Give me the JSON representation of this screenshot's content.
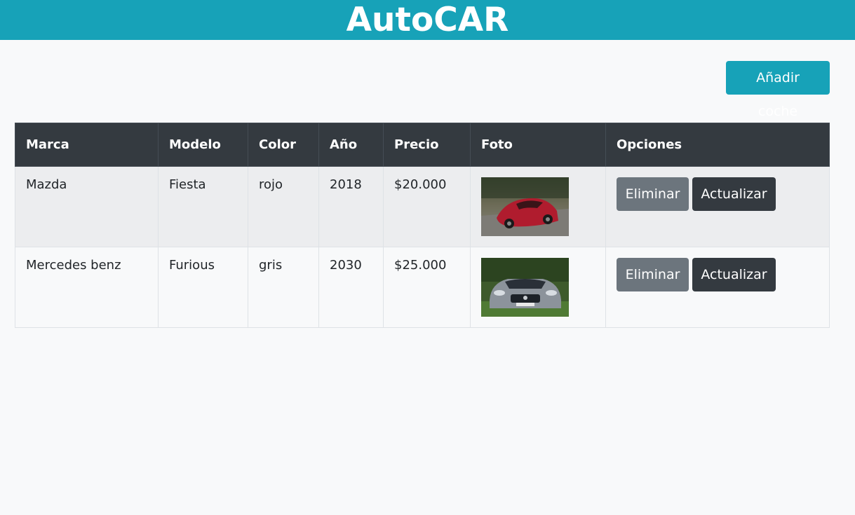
{
  "header": {
    "title": "AutoCAR"
  },
  "toolbar": {
    "add_label": "Añadir coche"
  },
  "table": {
    "columns": [
      "Marca",
      "Modelo",
      "Color",
      "Año",
      "Precio",
      "Foto",
      "Opciones"
    ],
    "rows": [
      {
        "marca": "Mazda",
        "modelo": "Fiesta",
        "color": "rojo",
        "anio": "2018",
        "precio": "$20.000",
        "foto": "red-sports-car-photo",
        "delete_label": "Eliminar",
        "update_label": "Actualizar"
      },
      {
        "marca": "Mercedes benz",
        "modelo": "Furious",
        "color": "gris",
        "anio": "2030",
        "precio": "$25.000",
        "foto": "gray-mercedes-photo",
        "delete_label": "Eliminar",
        "update_label": "Actualizar"
      }
    ]
  },
  "colors": {
    "brand": "#17a2b8",
    "table_header": "#343a40",
    "secondary": "#6c757d"
  }
}
